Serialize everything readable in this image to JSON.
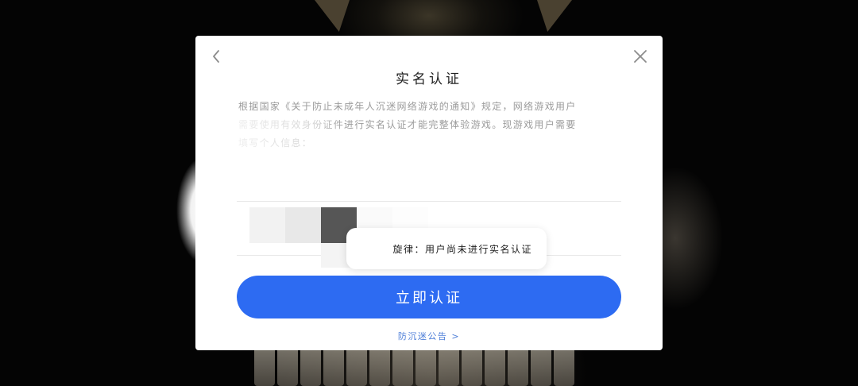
{
  "dialog": {
    "title": "实名认证",
    "notice_line1": "根据国家《关于防止未成年人沉迷网络游戏的通知》规定，网络游戏用户",
    "notice_line2": "需要使用有效身份证件进行实名认证才能完整体验游戏。现游戏用户需要",
    "notice_line3": "填写个人信息：",
    "back_icon": "chevron-left-icon",
    "close_icon": "close-icon",
    "toast_text": "旋律：用户尚未进行实名认证",
    "submit_label": "立即认证",
    "anti_addiction_link": "防沉迷公告 >"
  },
  "colors": {
    "accent": "#2d6bf2",
    "link": "#4f7fd8",
    "title": "#222222",
    "notice_text": "#9b9b9b"
  }
}
